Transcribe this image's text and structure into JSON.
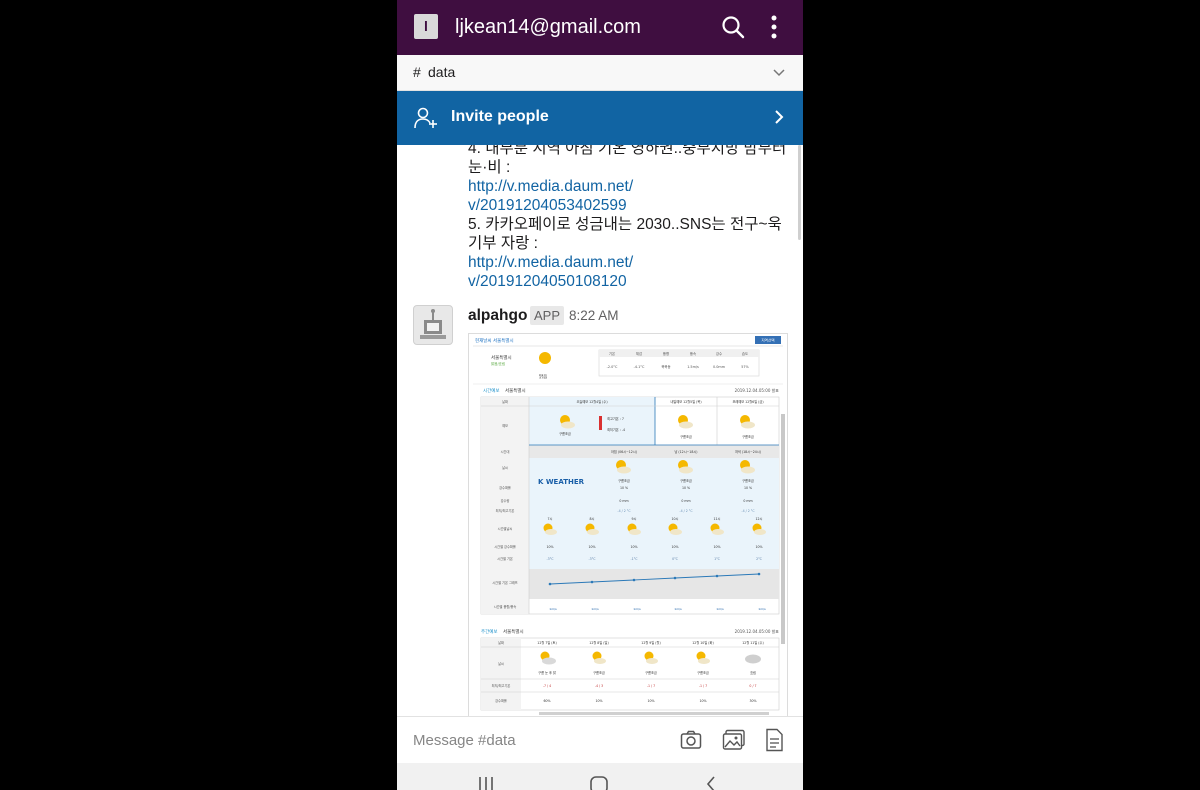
{
  "header": {
    "workspace_initial": "l",
    "account": "ljkean14@gmail.com",
    "search_icon": "search-icon",
    "more_icon": "more-vertical-icon"
  },
  "channel_bar": {
    "hash": "#",
    "channel": "data"
  },
  "invite": {
    "label": "Invite people"
  },
  "messages": {
    "prev_lines": [
      "4. 내부분 지역 아침 기온 영하권..중부지방 밤부터",
      "눈·비 :",
      "http://v.media.daum.net/",
      "v/20191204053402599",
      "5. 카카오페이로 성금내는 2030..SNS는 전구~욱",
      "기부 자랑 :",
      "http://v.media.daum.net/",
      "v/20191204050108120"
    ],
    "sender": "alpahgo",
    "badge": "APP",
    "time": "8:22 AM"
  },
  "weather": {
    "breadcrumb": "현재날씨 서울특별시",
    "corner_btn": "지역선택",
    "city": "서울특별시",
    "city_sub": "맑음/흐림",
    "current_condition": "맑음",
    "stat_headers": [
      "기온",
      "체감",
      "풍향",
      "풍속",
      "강수",
      "습도"
    ],
    "stat_values": [
      "-2.0°C",
      "-4.1°C",
      "북북동",
      "1.5m/s",
      "0.0mm",
      "57%"
    ],
    "forecast_title": "시간예보",
    "forecast_city": "서울특별시",
    "issued": "2019.12.04.05:00 발표",
    "row_labels": [
      "날짜",
      "예보",
      "시간대",
      "날씨",
      "강수확률",
      "강수량",
      "최저/최고기온",
      "시간별날씨",
      "시간별 강수확률",
      "시간별 기온",
      "시간별 기온 그래프",
      "시간별 풍향/풍속"
    ],
    "day_headers": [
      "오늘예보 12월4일 (수)",
      "내일예보 12월5일 (목)",
      "모레예보 12월6일 (금)"
    ],
    "today_cond": "구름조금",
    "today_max": "최고기온 : 7",
    "today_min": "최저기온 : -4",
    "tomorrow_cond": "구름조금",
    "dayafter_cond": "구름조금",
    "periods": [
      "아침 (06시~12시)",
      "낮 (12시~18시)",
      "저녁 (18시~24시)"
    ],
    "logo": "K WEATHER",
    "period_cond": [
      "구름조금",
      "구름조금",
      "구름조금"
    ],
    "period_pop": [
      "10 %",
      "10 %",
      "10 %"
    ],
    "period_rain": [
      "0 mm",
      "0 mm",
      "0 mm"
    ],
    "period_temp": [
      "-4 / 2 °C",
      "-4 / 2 °C",
      "-4 / 2 °C"
    ],
    "hours": [
      "7시",
      "8시",
      "9시",
      "10시",
      "11시",
      "12시"
    ],
    "hour_pop": [
      "10%",
      "10%",
      "10%",
      "10%",
      "10%",
      "10%"
    ],
    "hour_temp": [
      "-3°C",
      "-3°C",
      "-1°C",
      "0°C",
      "1°C",
      "2°C"
    ],
    "hour_wind": [
      "1m/s",
      "1m/s",
      "1m/s",
      "1m/s",
      "1m/s",
      "1m/s"
    ],
    "weekly_title": "주간예보",
    "weekly_city": "서울특별시",
    "weekly_issued": "2019.12.04.05:00 발표",
    "weekly_label_date": "날짜",
    "weekly_label_weather": "날씨",
    "weekly_label_temp": "최저/최고기온",
    "weekly_label_pop": "강수확률",
    "weekly_days": [
      "12월 7일 (토)",
      "12월 8일 (일)",
      "12월 9일 (월)",
      "12월 10일 (화)",
      "12월 11일 (수)"
    ],
    "weekly_cond": [
      "구름 눈 후 맑",
      "구름조금",
      "구름조금",
      "구름조금",
      "흐림"
    ],
    "weekly_temp": [
      "-7 / 4",
      "-4 / 3",
      "-1 / 7",
      "-1 / 7",
      "0 / 7"
    ],
    "weekly_pop": [
      "60%",
      "10%",
      "10%",
      "10%",
      "30%"
    ]
  },
  "composer": {
    "placeholder": "Message #data"
  }
}
